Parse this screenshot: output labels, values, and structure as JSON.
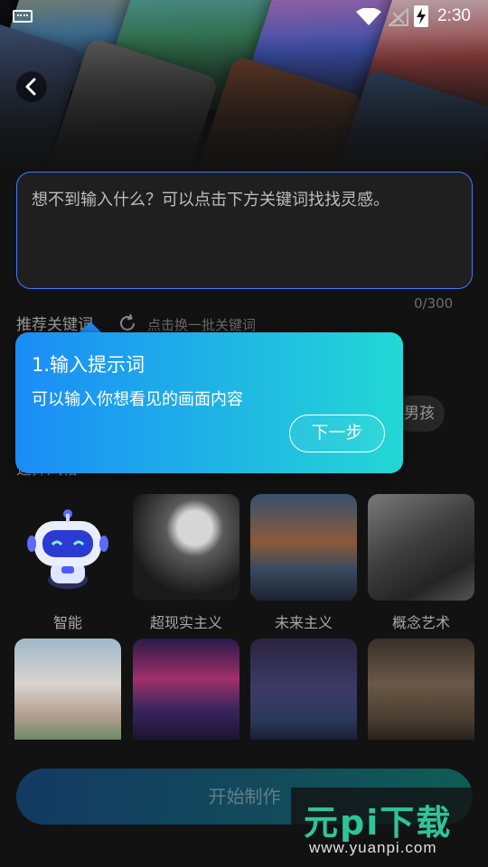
{
  "status_bar": {
    "time": "2:30"
  },
  "prompt": {
    "placeholder": "想不到输入什么？可以点击下方关键词找找灵感。",
    "counter": "0/300"
  },
  "keywords": {
    "title": "推荐关键词",
    "refresh_hint": "点击换一批关键词",
    "chips": [
      "男孩"
    ]
  },
  "styles": {
    "title": "选择风格",
    "items": [
      {
        "label": "智能"
      },
      {
        "label": "超现实主义"
      },
      {
        "label": "未来主义"
      },
      {
        "label": "概念艺术"
      }
    ]
  },
  "tooltip": {
    "title": "1.输入提示词",
    "description": "可以输入你想看见的画面内容",
    "next_label": "下一步"
  },
  "start_button": {
    "label": "开始制作"
  },
  "watermark": {
    "logo": "元pi下载",
    "url": "www.yuanpi.com"
  },
  "colors": {
    "accent": "#3b7bff",
    "tip_start": "#1b8cf7",
    "tip_end": "#23d8d5"
  }
}
